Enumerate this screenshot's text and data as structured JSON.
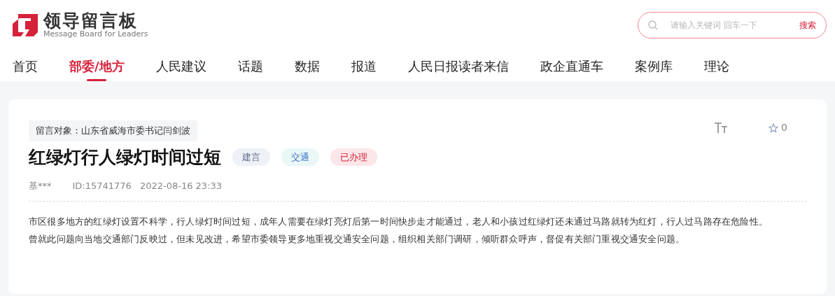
{
  "logo": {
    "title": "领导留言板",
    "subtitle": "Message Board for Leaders"
  },
  "search": {
    "placeholder": "请输入关键词 回车一下",
    "button": "搜索"
  },
  "nav": [
    {
      "label": "首页",
      "selected": false
    },
    {
      "label": "部委/地方",
      "selected": true
    },
    {
      "label": "人民建议",
      "selected": false
    },
    {
      "label": "话题",
      "selected": false
    },
    {
      "label": "数据",
      "selected": false
    },
    {
      "label": "报道",
      "selected": false
    },
    {
      "label": "人民日报读者来信",
      "selected": false
    },
    {
      "label": "政企直通车",
      "selected": false
    },
    {
      "label": "案例库",
      "selected": false
    },
    {
      "label": "理论",
      "selected": false
    }
  ],
  "message": {
    "recipient": "留言对象：山东省威海市委书记闫剑波",
    "favorites": "0",
    "title": "红绿灯行人绿灯时间过短",
    "tags": [
      {
        "label": "建言",
        "color": "#eef1f7"
      },
      {
        "label": "交通",
        "color": "#e9f8f7"
      },
      {
        "label": "已办理",
        "color": "#fbe7ea"
      }
    ],
    "author": "基***",
    "id": "ID:15741776",
    "time": "2022-08-16 23:33",
    "paragraphs": [
      "市区很多地方的红绿灯设置不科学，行人绿灯时间过短，成年人需要在绿灯亮灯后第一时间快步走才能通过，老人和小孩过红绿灯还未通过马路就转为红灯，行人过马路存在危险性。",
      "曾就此问题向当地交通部门反映过，但未见改进，希望市委领导更多地重视交通安全问题，组织相关部门调研，倾听群众呼声，督促有关部门重视交通安全问题。"
    ]
  }
}
